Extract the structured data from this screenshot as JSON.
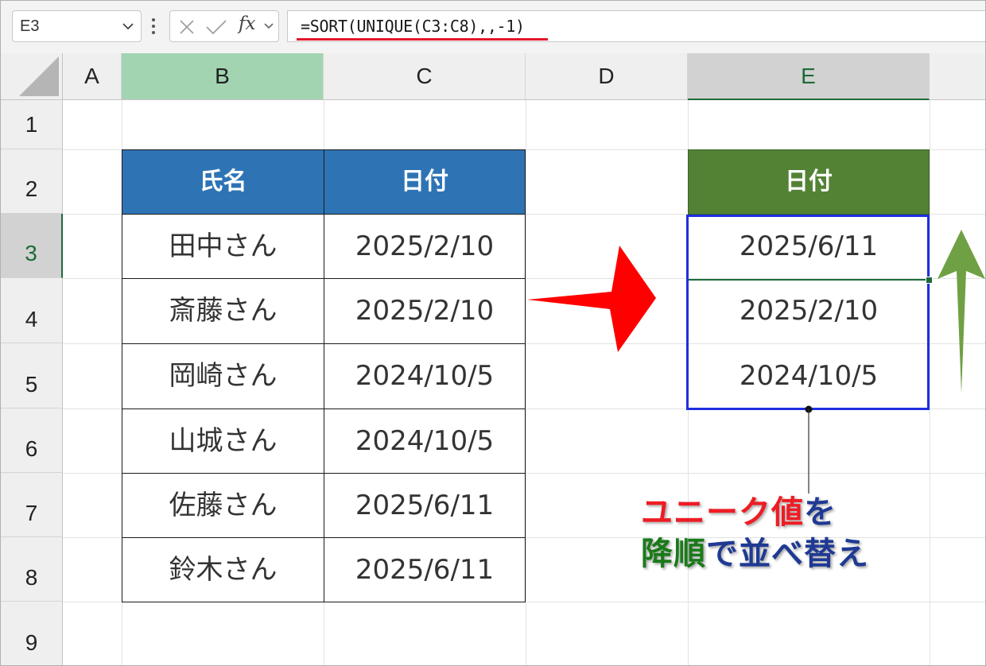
{
  "formula_bar": {
    "name_box": "E3",
    "fx_label": "fx",
    "formula": "=SORT(UNIQUE(C3:C8),,-1)"
  },
  "columns": [
    "A",
    "B",
    "C",
    "D",
    "E"
  ],
  "rows": [
    "1",
    "2",
    "3",
    "4",
    "5",
    "6",
    "7",
    "8",
    "9"
  ],
  "selected_cell": {
    "column": "E",
    "row": "3"
  },
  "source_table": {
    "headers": [
      "氏名",
      "日付"
    ],
    "rows": [
      [
        "田中さん",
        "2025/2/10"
      ],
      [
        "斎藤さん",
        "2025/2/10"
      ],
      [
        "岡崎さん",
        "2024/10/5"
      ],
      [
        "山城さん",
        "2024/10/5"
      ],
      [
        "佐藤さん",
        "2025/6/11"
      ],
      [
        "鈴木さん",
        "2025/6/11"
      ]
    ]
  },
  "result_table": {
    "header": "日付",
    "values": [
      "2025/6/11",
      "2025/2/10",
      "2024/10/5"
    ]
  },
  "callout": {
    "line1_red": "ユニーク値",
    "line1_blue": "を",
    "line2_green": "降順",
    "line2_blue": "で並べ替え"
  },
  "colors": {
    "source_header": "#2e74b5",
    "result_header": "#548235",
    "spill_border": "#1f2ee0",
    "arrow_right": "#ff0000",
    "arrow_up": "#70a044",
    "callout_red": "#ee1c24",
    "callout_green": "#1a7a1a",
    "callout_blue": "#1f3a93"
  },
  "icons": [
    "chevron-down-icon",
    "cancel-icon",
    "enter-icon",
    "fx-icon",
    "select-all-icon",
    "right-arrow-icon",
    "up-arrow-icon"
  ]
}
